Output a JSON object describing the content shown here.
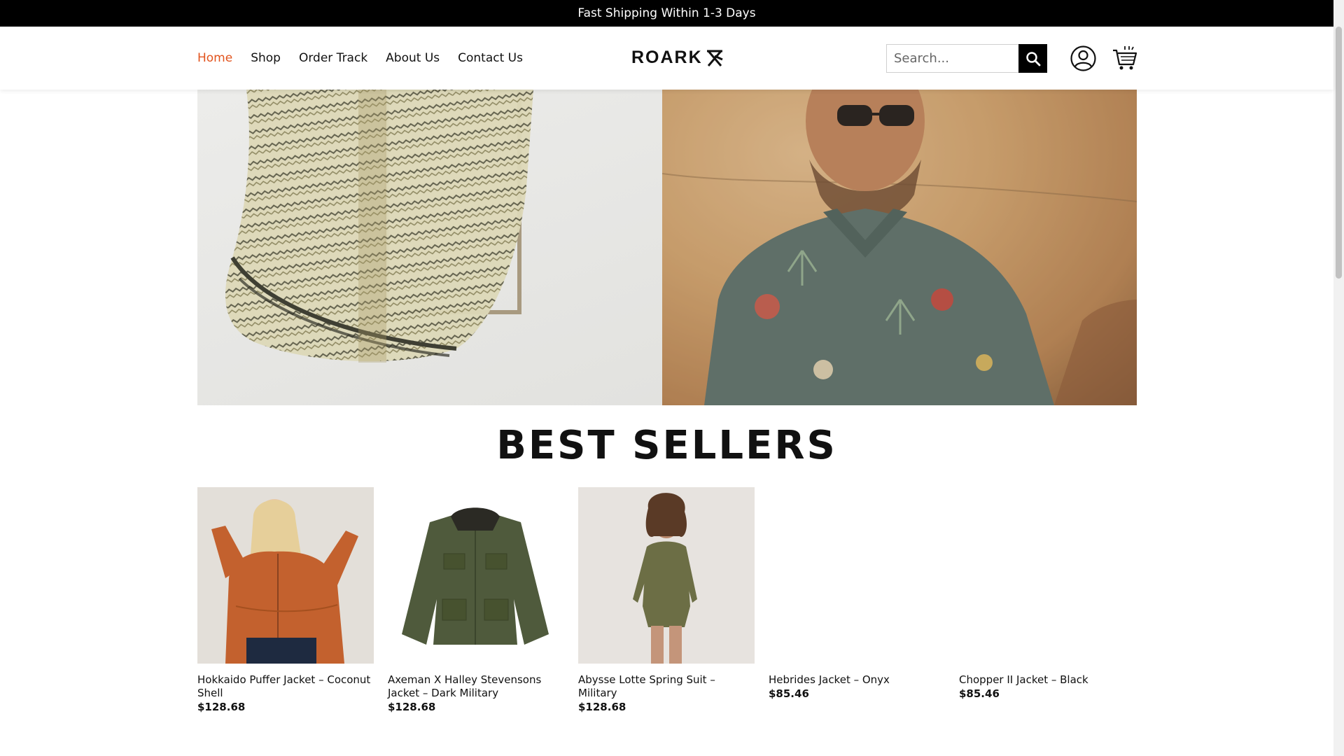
{
  "announcement": "Fast Shipping Within 1-3 Days",
  "nav": {
    "items": [
      {
        "label": "Home",
        "active": true
      },
      {
        "label": "Shop",
        "active": false
      },
      {
        "label": "Order Track",
        "active": false
      },
      {
        "label": "About Us",
        "active": false
      },
      {
        "label": "Contact Us",
        "active": false
      }
    ]
  },
  "brand": {
    "logo_text": "ROARK"
  },
  "search": {
    "placeholder": "Search...",
    "button_icon": "search-icon"
  },
  "icons": {
    "account": "user-circle-icon",
    "cart": "shopping-cart-icon"
  },
  "colors": {
    "accent": "#e2541e",
    "topbar": "#000000"
  },
  "section": {
    "title": "BEST SELLERS"
  },
  "products": [
    {
      "name": "Hokkaido Puffer Jacket – Coconut Shell",
      "price": "$128.68"
    },
    {
      "name": "Axeman X Halley Stevensons Jacket – Dark Military",
      "price": "$128.68"
    },
    {
      "name": "Abysse Lotte Spring Suit – Military",
      "price": "$128.68"
    },
    {
      "name": "Hebrides Jacket – Onyx",
      "price": "$85.46"
    },
    {
      "name": "Chopper II Jacket – Black",
      "price": "$85.46"
    }
  ]
}
